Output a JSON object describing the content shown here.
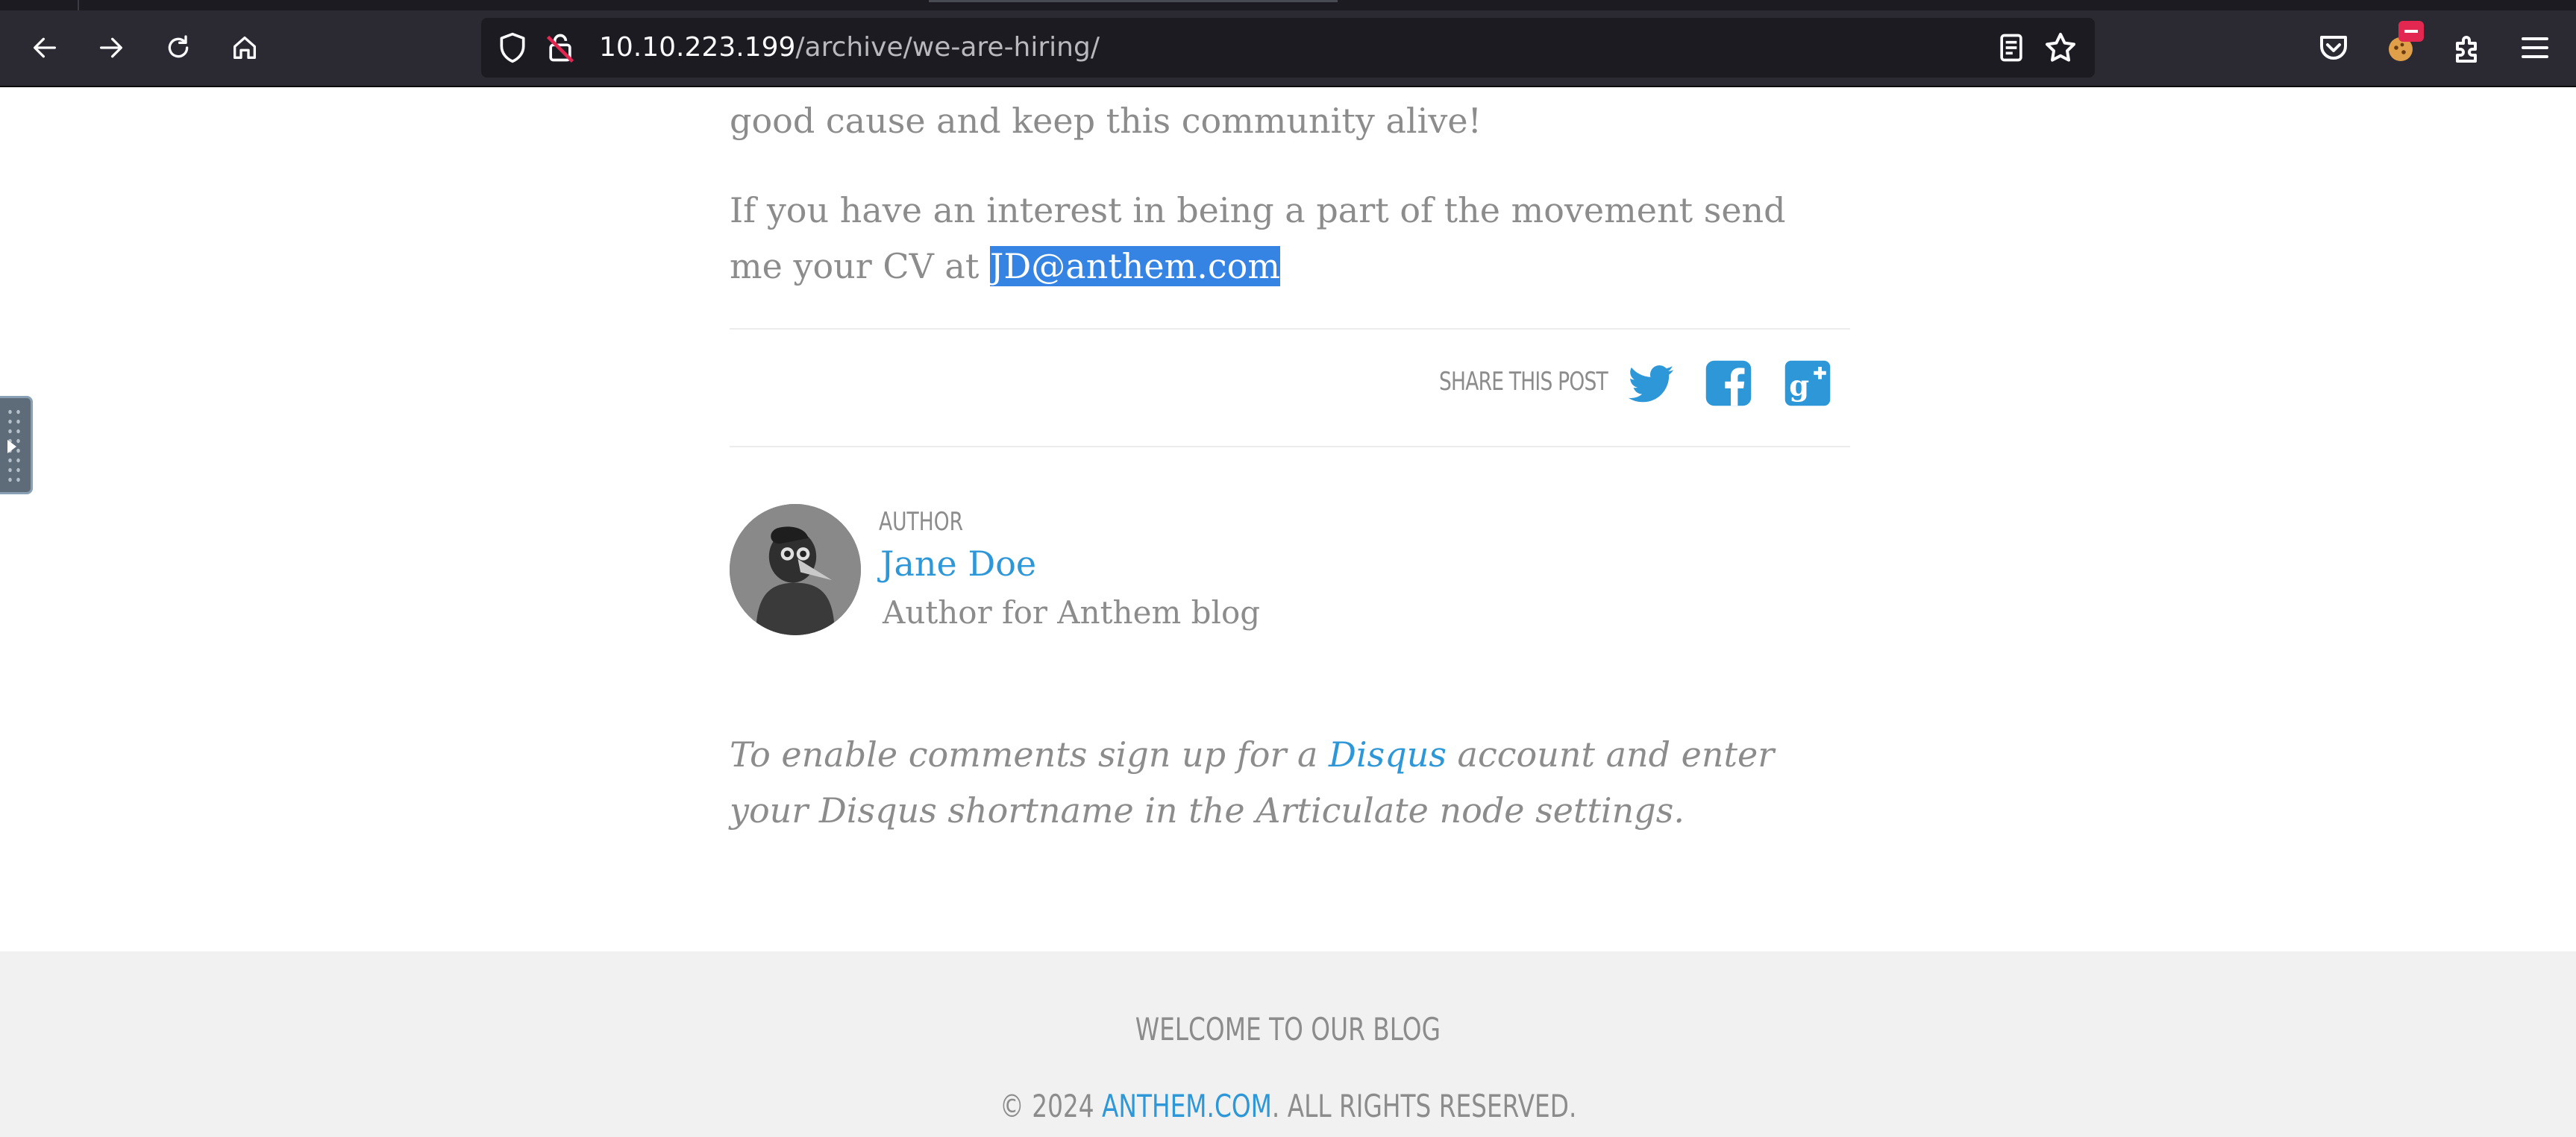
{
  "browser": {
    "url_host": "10.10.223.199",
    "url_path": "/archive/we-are-hiring/"
  },
  "post": {
    "para_1": "good cause and keep this community alive!",
    "para_2_prefix": "If you have an interest in being a part of the movement send me your CV at ",
    "email": "JD@anthem.com",
    "share_label": "SHARE THIS POST"
  },
  "author": {
    "label": "AUTHOR",
    "name": "Jane Doe",
    "bio": "Author for Anthem blog"
  },
  "comments": {
    "prefix": "To enable comments sign up for a ",
    "link": "Disqus",
    "suffix": " account and enter your Disqus shortname in the Articulate node settings."
  },
  "footer": {
    "title": "WELCOME TO OUR BLOG",
    "copyright_prefix": "© 2024 ",
    "copyright_link": "ANTHEM.COM",
    "copyright_suffix": ". ALL RIGHTS RESERVED."
  },
  "colors": {
    "link": "#2e97d8",
    "selection": "#3584e4",
    "text": "#8c8c8c"
  }
}
